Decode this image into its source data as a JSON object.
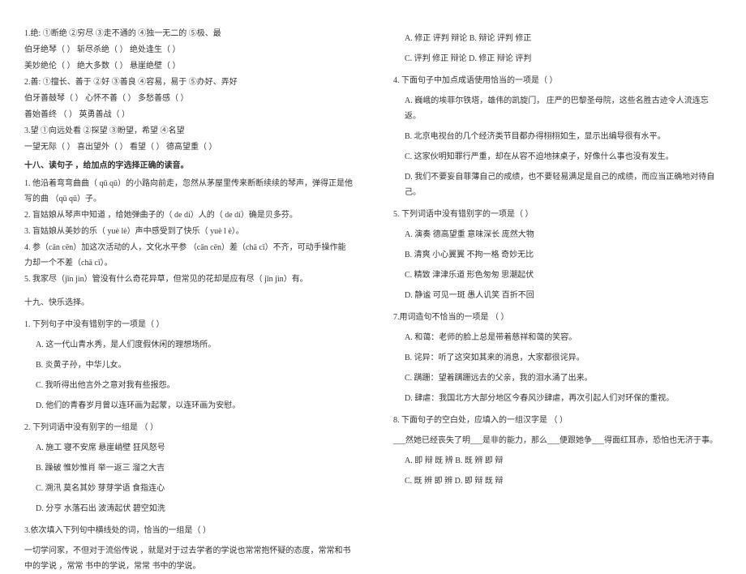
{
  "left": {
    "q1": {
      "header": "1.绝: ①断绝 ②穷尽 ③走不通的 ④独一无二的   ⑤极、最",
      "l1": "伯牙绝琴（        ）  斩尽杀绝（        ）    绝处逢生（        ）",
      "l2": "美妙绝伦（        ）  绝大多数（        ）    悬崖绝壁（        ）"
    },
    "q2": {
      "header": "2.善: ①擅长、善于  ②好  ③善良  ④容易，易于 ⑤办好、弄好",
      "l1": "伯牙善鼓琴（        ）    心怀不善（        ）    多愁善感（        ）",
      "l2": "善始善终 （        ）    英勇善战（        ）"
    },
    "q3": {
      "header": "3.望 ①向远处看 ②探望 ③盼望，希望 ④名望",
      "l1": "一望无际（        ） 喜出望外（        ） 看望（        ）   德高望重（        ）"
    },
    "q18": {
      "title": "十八、读句子  ，给加点的字选择正确的读音。",
      "l1": "   1. 他沿着弯弯曲曲（ qū  qǔ）的小路向前走，忽然从茅屋里传来断断续续的琴声，弹得正是他写的曲 （qū  qǔ）子。",
      "l2": "   2. 盲姑娘从琴声中知道  ，给她弹曲子的（ de  dí）人的（ de  dí）确是贝多芬。",
      "l3": "   3. 盲姑娘从美妙的乐（ yuè  lè）声中感受到了快乐（ yuè  l è）。",
      "l4": "   4. 参（cān  cēn）加这次活动的人，文化水平参 （cān  cēn）差（chā  cī）不齐，可动手操作能力却一个不差（chā  cī）。",
      "l5": "   5. 我家尽（jǐn  jìn）管没有什么奇花异草，但常见的花却是应有尽（ jǐn  jìn）有。"
    },
    "q19": {
      "title": "十九、快乐选择。",
      "sub1": {
        "q": "  1. 下列句子中没有错别字的一项是（    ）",
        "a": "A. 这一代山青水秀，是人们度假休闲的理想场所。",
        "b": "B. 炎黄子孙，中华儿女。",
        "c": "C. 我听得出他言外之意对我有些报怨。",
        "d": "D. 他们的青春岁月曾以连环画为起蒙，以连环画为安慰。"
      },
      "sub2": {
        "q": "  2. 下列词语中没有别字的一组是  （    ）",
        "a": "A. 施工    寝不安席    悬崖峭壁    狂风怒号",
        "b": "B. 躁破    惟妙惟肖    举一返三    溜之大吉",
        "c": "C. 溯汛    莫名其妙    芽芽学语    食指连心",
        "d": "D. 分亨    水落石出    波涛起伏    碧空如洗"
      },
      "sub3": {
        "q": "  3.依次填入下列句中横线处的词，恰当的一组是（    ）",
        "text": "             一切学问家，不但对于流俗传说  ，就是对于过去学者的学说也常常抱怀疑的态度，常常和书中的学说          ，常常         书中的学说，常常          书中的学说。"
      }
    }
  },
  "right": {
    "sub3_options": {
      "a": "A. 修正   评判   辩论            B. 辩论   评判   修正",
      "c": "C. 评判   修正   辩论            D. 修正   辩论   评判"
    },
    "sub4": {
      "q": "4. 下面句子中加点成语使用恰当的一项是（    ）",
      "a": "A. 巍峨的埃菲尔铁塔，雄伟的凯旋门， 庄严的巴黎圣母院，这些名胜古迹令人流连忘返。",
      "b": "B. 北京电视台的几个经济类节目都办得栩栩如生，显示出编导很有水平。",
      "c": "C. 这家伙明知罪行严重，却在从容不迫地抹桌子，好像什么事也没有发生。",
      "d": "D. 我们不要妄自菲薄自己的成绩，也不要轻易满足是自己的成绩，而应当正确地对待自己。"
    },
    "sub5": {
      "q": "5. 下列词语中没有错别字的一项是（    ）",
      "a": "A. 演奏      德高望重      意味深长      庞然大物",
      "b": "B. 清爽   小心翼翼   不拘一格    奇妙无比",
      "c": "C. 精致   津津乐道    形色匆匆   思潮起伏",
      "d": "D. 静谧    可见一斑    愚人讥笑   百折不回"
    },
    "sub7": {
      "q": "7.用词造句不恰当的一项是  （    ）",
      "a": "A. 和蔼：老师的脸上总是带着慈祥和蔼的笑容。",
      "b": "B. 诧异：听了这突如其来的消息，大家都很诧异。",
      "c": "C. 蹒跚：望着蹒跚远去的父亲，我的泪水涌了出来。",
      "d": "D. 肆虐：我国北方大部分地区今春风沙肆虐，再次引起人们对环保的重视。"
    },
    "sub8": {
      "q": "8. 下面句子的空白处，应填入的一组汉字是  （    ）",
      "text": "    ___然她已经丧失了明___是非的能力，那么___便跟她争___得面红耳赤，恐怕也无济于事。",
      "a": "A. 即   辩   既   辨        B. 既   辨   即   辩",
      "c": "C. 既   辨   即   辨        D. 即   辩   既   辩"
    }
  }
}
